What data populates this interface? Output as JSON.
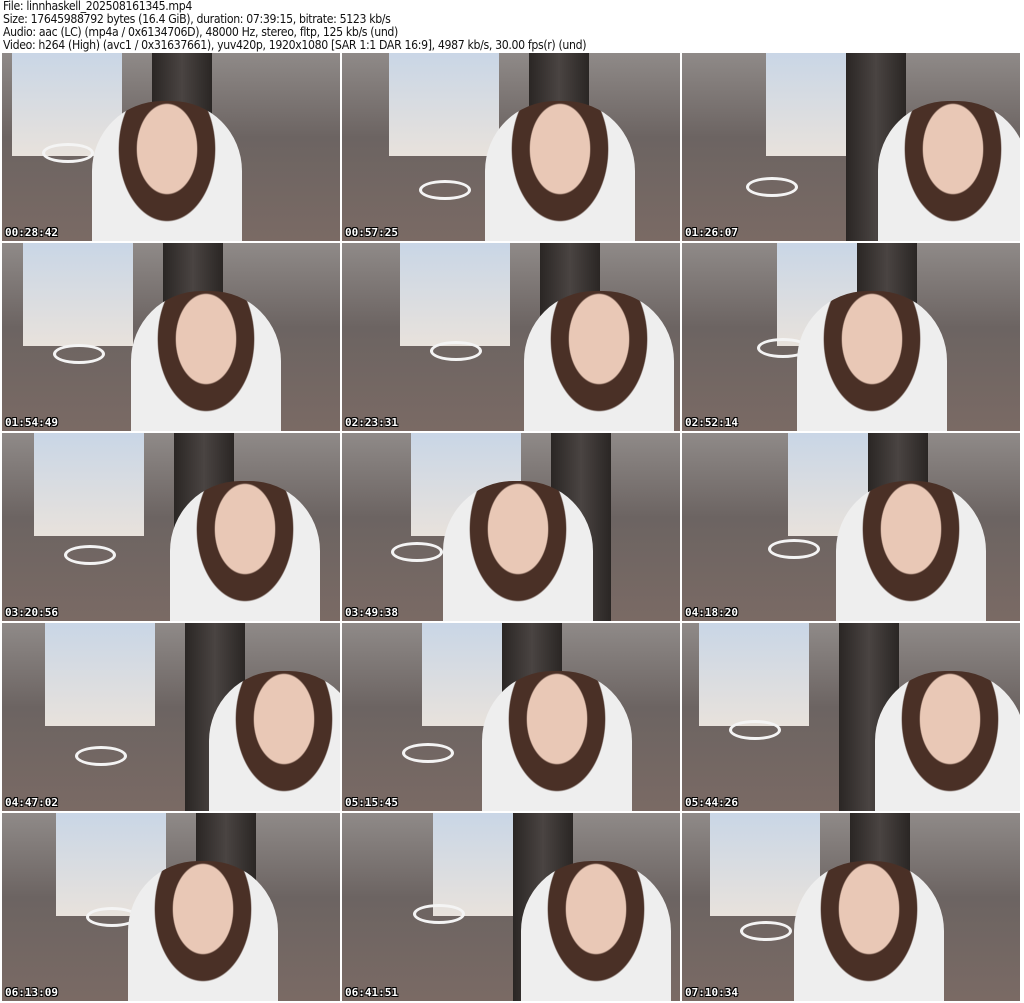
{
  "header": {
    "file": "File: linnhaskell_202508161345.mp4",
    "size": "Size: 17645988792 bytes (16.4 GiB), duration: 07:39:15, bitrate: 5123 kb/s",
    "audio": "Audio: aac (LC) (mp4a / 0x6134706D), 48000 Hz, stereo, fltp, 125 kb/s (und)",
    "video": "Video: h264 (High) (avc1 / 0x31637661), yuv420p, 1920x1080 [SAR 1:1 DAR 16:9], 4987 kb/s, 30.00 fps(r) (und)"
  },
  "thumbnails": [
    {
      "timestamp": "00:28:42"
    },
    {
      "timestamp": "00:57:25"
    },
    {
      "timestamp": "01:26:07"
    },
    {
      "timestamp": "01:54:49"
    },
    {
      "timestamp": "02:23:31"
    },
    {
      "timestamp": "02:52:14"
    },
    {
      "timestamp": "03:20:56"
    },
    {
      "timestamp": "03:49:38"
    },
    {
      "timestamp": "04:18:20"
    },
    {
      "timestamp": "04:47:02"
    },
    {
      "timestamp": "05:15:45"
    },
    {
      "timestamp": "05:44:26"
    },
    {
      "timestamp": "06:13:09"
    },
    {
      "timestamp": "06:41:51"
    },
    {
      "timestamp": "07:10:34"
    }
  ]
}
